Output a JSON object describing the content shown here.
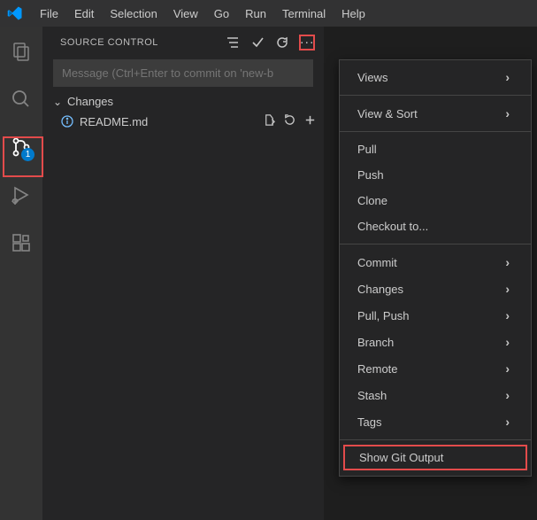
{
  "menubar": [
    "File",
    "Edit",
    "Selection",
    "View",
    "Go",
    "Run",
    "Terminal",
    "Help"
  ],
  "activity": {
    "scm_badge": "1"
  },
  "scm": {
    "title": "Source Control",
    "message_placeholder": "Message (Ctrl+Enter to commit on 'new-b",
    "changes_label": "Changes",
    "file": "README.md"
  },
  "ctx": {
    "views": "Views",
    "view_sort": "View & Sort",
    "pull": "Pull",
    "push": "Push",
    "clone": "Clone",
    "checkout": "Checkout to...",
    "commit": "Commit",
    "changes": "Changes",
    "pull_push": "Pull, Push",
    "branch": "Branch",
    "remote": "Remote",
    "stash": "Stash",
    "tags": "Tags",
    "show_git": "Show Git Output"
  }
}
